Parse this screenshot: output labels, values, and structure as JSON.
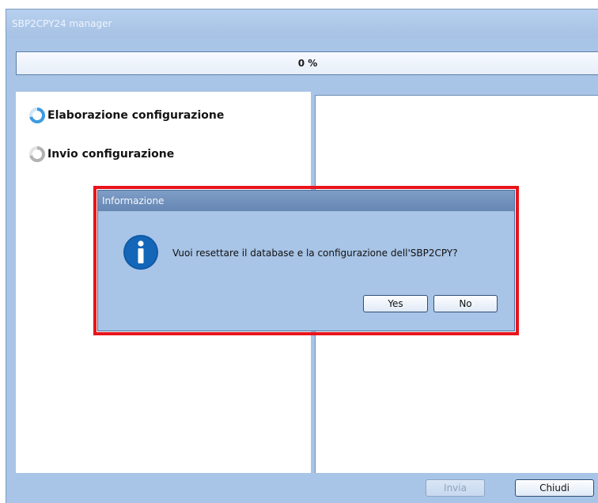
{
  "window": {
    "title": "SBP2CPY24 manager"
  },
  "progress": {
    "text": "0 %",
    "fraction": 0.0
  },
  "steps": [
    {
      "label": "Elaborazione configurazione",
      "state": "in-progress"
    },
    {
      "label": "Invio configurazione",
      "state": "pending"
    }
  ],
  "footer": {
    "send_label": "Invia",
    "close_label": "Chiudi"
  },
  "dialog": {
    "title": "Informazione",
    "icon": "info-icon",
    "message": "Vuoi resettare il database e la configurazione dell'SBP2CPY?",
    "yes_label": "Yes",
    "no_label": "No"
  },
  "colors": {
    "window_background": "#a8c4e6",
    "highlight_border": "#e8141b",
    "info_icon": "#0f5aa6",
    "spinner_active": "#3d9be0"
  }
}
